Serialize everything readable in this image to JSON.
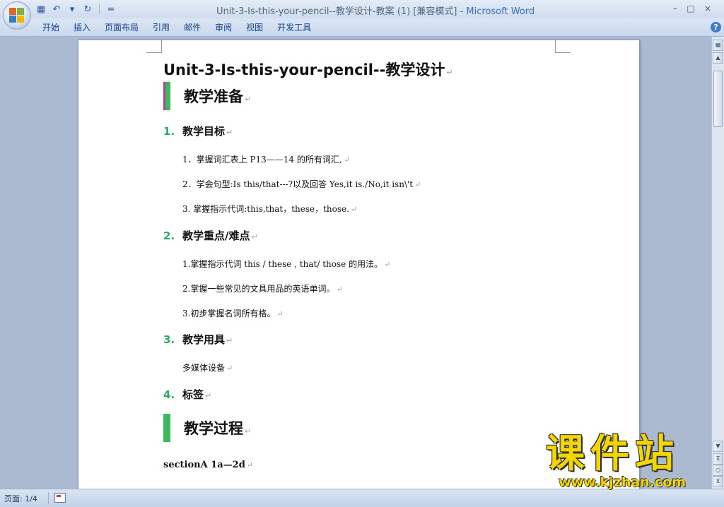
{
  "window": {
    "title_doc": "Unit-3-Is-this-your-pencil--教学设计-教案 (1) [兼容模式]",
    "title_sep": " - ",
    "title_app": "Microsoft Word",
    "minimize": "–",
    "maximize": "□",
    "close": "×"
  },
  "quick_access": {
    "save_icon": "save-icon",
    "undo_icon": "undo-icon",
    "redo_icon": "redo-icon",
    "dropdown": "▾",
    "customize": "="
  },
  "ribbon": {
    "tabs": [
      "开始",
      "插入",
      "页面布局",
      "引用",
      "邮件",
      "审阅",
      "视图",
      "开发工具"
    ],
    "help": "?"
  },
  "document": {
    "title": "Unit-3-Is-this-your-pencil--教学设计",
    "para_mark": "↵",
    "section1": "教学准备",
    "items": [
      {
        "num": "1.",
        "title": "教学目标"
      },
      {
        "num": "2.",
        "title": "教学重点/难点"
      },
      {
        "num": "3.",
        "title": "教学用具"
      },
      {
        "num": "4.",
        "title": "标签"
      }
    ],
    "goals": [
      "1．掌握词汇表上 P13——14 的所有词汇,",
      "2．学会句型:Is this/that---?以及回答 Yes,it is./No,it isn\\'t",
      "3. 掌握指示代词:this,that，these，those."
    ],
    "key_points": [
      "1.掌握指示代词 this / these , that/ those 的用法。",
      "2.掌握一些常见的文具用品的英语单词。",
      "3.初步掌握名词所有格。"
    ],
    "tools": "多媒体设备",
    "section2": "教学过程",
    "section_a": "sectionA  1a—2d"
  },
  "scrollbar": {
    "up": "▲",
    "down": "▼",
    "prev": "⊼",
    "select_browse": "○",
    "next": "⊻"
  },
  "watermark": {
    "cn": "课件站",
    "url": "www.kjzhan.com"
  },
  "status": {
    "page": "页面: 1/4"
  }
}
